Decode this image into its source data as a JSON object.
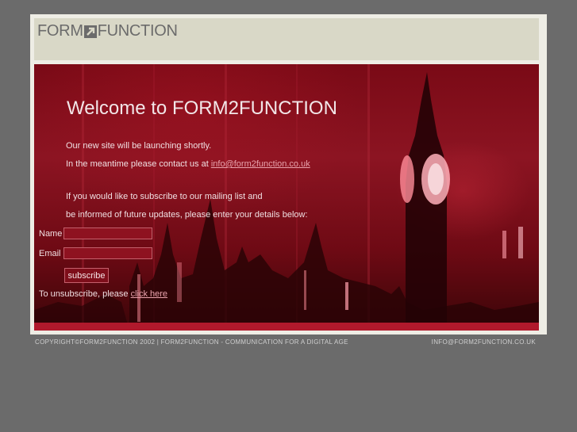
{
  "header": {
    "logo_left": "FORM",
    "logo_right": "FUNCTION",
    "logo_arrow_icon": "arrow-up-right-icon"
  },
  "hero": {
    "title": "Welcome to FORM2FUNCTION",
    "line1": "Our new site will be launching shortly.",
    "line2_prefix": "In the meantime please contact us at ",
    "line2_email": "info@form2function.co.uk",
    "line3": "If you would like to subscribe to our mailing list and",
    "line4": "be informed of future updates, please enter your details below:"
  },
  "form": {
    "name_label": "Name",
    "name_value": "",
    "email_label": "Email",
    "email_value": "",
    "subscribe_label": "subscribe",
    "unsubscribe_prefix": "To unsubscribe, please ",
    "unsubscribe_link": "click here"
  },
  "footer": {
    "left": "COPYRIGHT©FORM2FUNCTION 2002 | FORM2FUNCTION - COMMUNICATION FOR A DIGITAL AGE",
    "right": "INFO@FORM2FUNCTION.CO.UK"
  },
  "colors": {
    "page_bg": "#6b6b6b",
    "frame_bg": "#eeede5",
    "header_bg": "#d9d8c7",
    "hero_red": "#8c1422"
  }
}
